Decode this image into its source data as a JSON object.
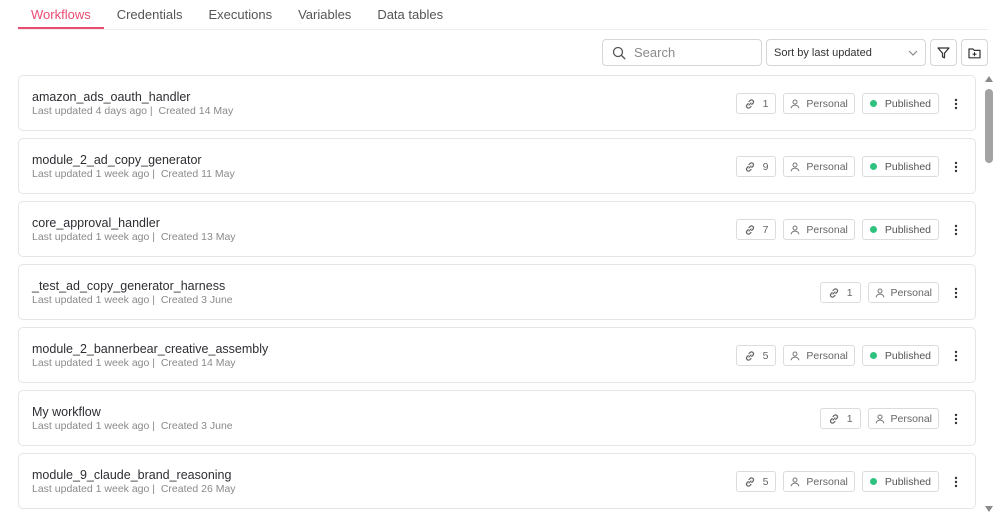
{
  "tabs": [
    {
      "label": "Workflows",
      "active": true
    },
    {
      "label": "Credentials",
      "active": false
    },
    {
      "label": "Executions",
      "active": false
    },
    {
      "label": "Variables",
      "active": false
    },
    {
      "label": "Data tables",
      "active": false
    }
  ],
  "toolbar": {
    "search_placeholder": "Search",
    "sort_label": "Sort by last updated",
    "icons": [
      "search-icon",
      "chevron-down-icon",
      "filter-icon",
      "folder-plus-icon"
    ]
  },
  "colors": {
    "accent": "#ea4b71",
    "published_dot": "#2ec27e"
  },
  "workflows": [
    {
      "name": "amazon_ads_oauth_handler",
      "updated": "Last updated 4 days ago",
      "created": "Created 14 May",
      "links": "1",
      "owner": "Personal",
      "status": "Published"
    },
    {
      "name": "module_2_ad_copy_generator",
      "updated": "Last updated 1 week ago",
      "created": "Created 11 May",
      "links": "9",
      "owner": "Personal",
      "status": "Published"
    },
    {
      "name": "core_approval_handler",
      "updated": "Last updated 1 week ago",
      "created": "Created 13 May",
      "links": "7",
      "owner": "Personal",
      "status": "Published"
    },
    {
      "name": "_test_ad_copy_generator_harness",
      "updated": "Last updated 1 week ago",
      "created": "Created 3 June",
      "links": "1",
      "owner": "Personal",
      "status": ""
    },
    {
      "name": "module_2_bannerbear_creative_assembly",
      "updated": "Last updated 1 week ago",
      "created": "Created 14 May",
      "links": "5",
      "owner": "Personal",
      "status": "Published"
    },
    {
      "name": "My workflow",
      "updated": "Last updated 1 week ago",
      "created": "Created 3 June",
      "links": "1",
      "owner": "Personal",
      "status": ""
    },
    {
      "name": "module_9_claude_brand_reasoning",
      "updated": "Last updated 1 week ago",
      "created": "Created 26 May",
      "links": "5",
      "owner": "Personal",
      "status": "Published"
    }
  ]
}
